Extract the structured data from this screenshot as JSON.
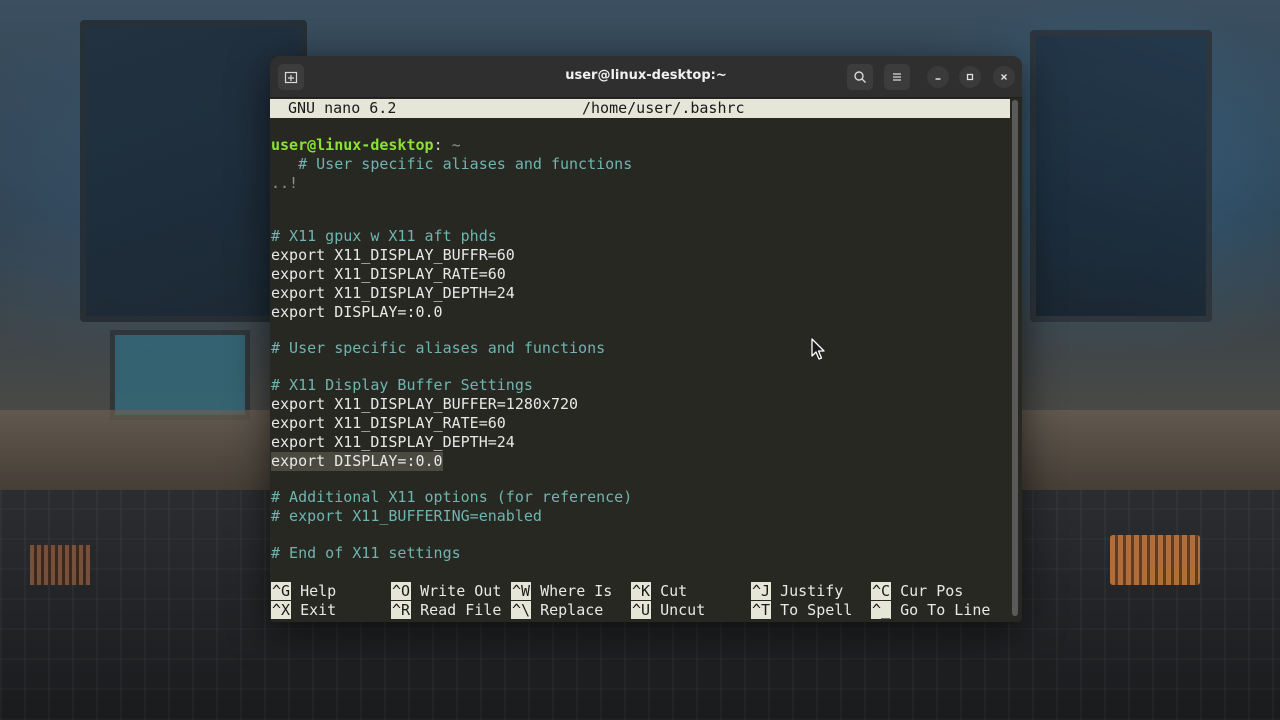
{
  "window": {
    "title": "user@linux-desktop:~"
  },
  "nano": {
    "version": "GNU nano 6.2",
    "filename": "/home/user/.bashrc"
  },
  "lines": [
    {
      "type": "prompt",
      "user": "user@linux-desktop",
      "sep": ":",
      "rest": " ~"
    },
    {
      "type": "comment",
      "text": "   # User specific aliases and functions"
    },
    {
      "type": "dim",
      "text": "..!"
    },
    {
      "type": "comment",
      "text": "# X11 gpux w X11 aft phds"
    },
    {
      "type": "code",
      "text": "export X11_DISPLAY_BUFFR=60"
    },
    {
      "type": "code",
      "text": "export X11_DISPLAY_RATE=60"
    },
    {
      "type": "code",
      "text": "export X11_DISPLAY_DEPTH=24"
    },
    {
      "type": "code",
      "text": "export DISPLAY=:0.0"
    },
    {
      "type": "comment",
      "text": "# User specific aliases and functions"
    },
    {
      "type": "comment",
      "text": "# X11 Display Buffer Settings"
    },
    {
      "type": "code",
      "text": "export X11_DISPLAY_BUFFER=1280x720"
    },
    {
      "type": "code",
      "text": "export X11_DISPLAY_RATE=60"
    },
    {
      "type": "code",
      "text": "export X11_DISPLAY_DEPTH=24"
    },
    {
      "type": "highlight",
      "text": "export DISPLAY=:0.0"
    },
    {
      "type": "comment",
      "text": "# Additional X11 options (for reference)"
    },
    {
      "type": "comment",
      "text": "# export X11_BUFFERING=enabled"
    },
    {
      "type": "comment",
      "text": "# End of X11 settings"
    }
  ],
  "shortcuts": [
    {
      "key": "^G",
      "label": " Help"
    },
    {
      "key": "^O",
      "label": " Write Out"
    },
    {
      "key": "^W",
      "label": " Where Is"
    },
    {
      "key": "^K",
      "label": " Cut"
    },
    {
      "key": "^J",
      "label": " Justify"
    },
    {
      "key": "^C",
      "label": " Cur Pos"
    },
    {
      "key": "^X",
      "label": " Exit"
    },
    {
      "key": "^R",
      "label": " Read File"
    },
    {
      "key": "^\\",
      "label": " Replace"
    },
    {
      "key": "^U",
      "label": " Uncut"
    },
    {
      "key": "^T",
      "label": " To Spell"
    },
    {
      "key": "^_",
      "label": " Go To Line"
    }
  ],
  "icons": {
    "new_tab": "new-tab-icon",
    "search": "search-icon",
    "menu": "hamburger-menu-icon",
    "minimize": "minimize-icon",
    "maximize": "maximize-icon",
    "close": "close-icon"
  },
  "colors": {
    "prompt_user": "#8ae234",
    "comment": "#6fb4b0",
    "terminal_bg": "#272822",
    "nano_bar": "#e6e6d8"
  }
}
